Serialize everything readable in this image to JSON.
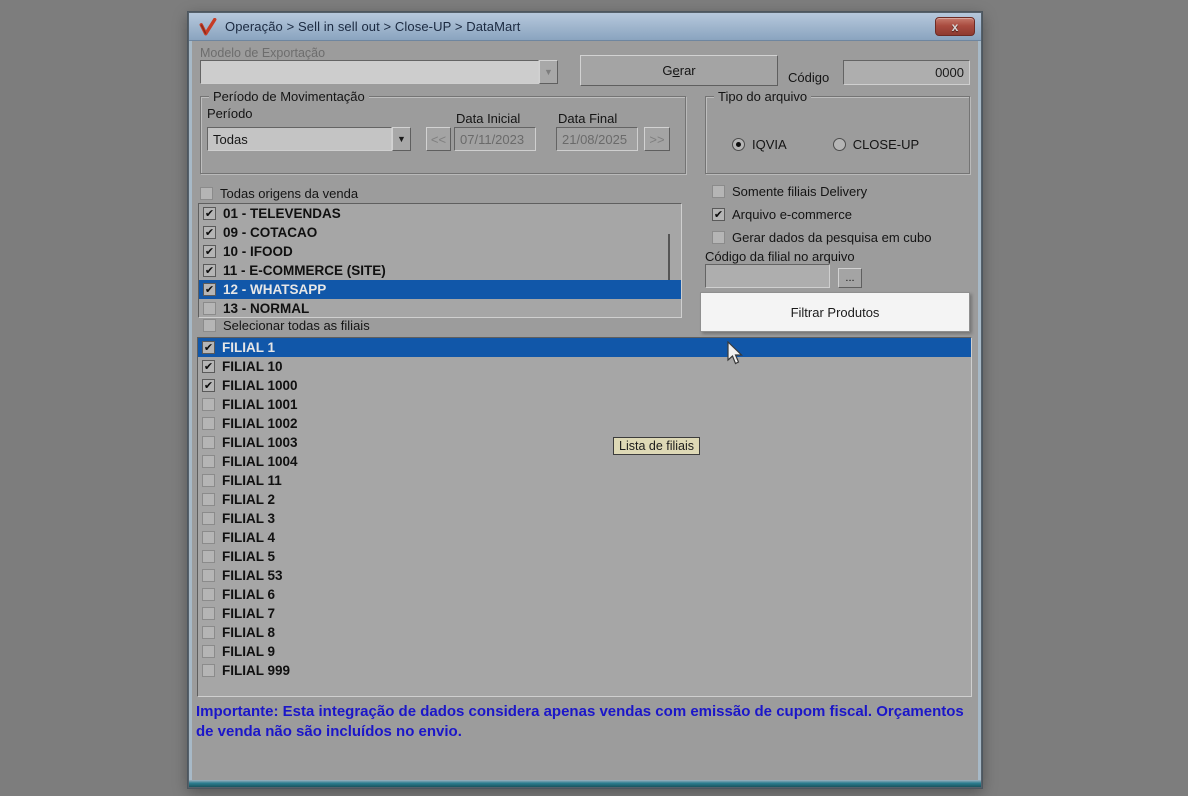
{
  "window": {
    "title": "Operação > Sell in sell out > Close-UP > DataMart",
    "close_glyph": "x"
  },
  "export_model": {
    "label": "Modelo de Exportação",
    "value": "",
    "arrow_glyph": "▼"
  },
  "gerar_button": {
    "pre": "G",
    "mnemonic": "e",
    "post": "rar"
  },
  "codigo": {
    "label": "Código",
    "value": "0000"
  },
  "periodo_group": {
    "title": "Período de Movimentação",
    "periodo_label": "Período",
    "periodo_value": "Todas",
    "arrow_glyph": "▼",
    "prev_label": "<<",
    "next_label": ">>",
    "data_inicial_label": "Data Inicial",
    "data_inicial_value": "07/11/2023",
    "data_final_label": "Data Final",
    "data_final_value": "21/08/2025"
  },
  "tipo_arquivo_group": {
    "title": "Tipo do arquivo",
    "options": [
      {
        "label": "IQVIA",
        "checked": true
      },
      {
        "label": "CLOSE-UP",
        "checked": false
      }
    ]
  },
  "origens": {
    "all_label": "Todas origens da venda",
    "all_checked": false,
    "items": [
      {
        "label": "01 - TELEVENDAS",
        "checked": true
      },
      {
        "label": "09 - COTACAO",
        "checked": true
      },
      {
        "label": "10 - IFOOD",
        "checked": true
      },
      {
        "label": "11 - E-COMMERCE (SITE)",
        "checked": true
      },
      {
        "label": "12 - WHATSAPP",
        "checked": true,
        "selected": true
      },
      {
        "label": "13 - NORMAL",
        "checked": false
      }
    ]
  },
  "opcoes": {
    "items": [
      {
        "label": "Somente filiais Delivery",
        "checked": false
      },
      {
        "label": "Arquivo e-commerce",
        "checked": true
      },
      {
        "label": "Gerar dados da pesquisa em cubo",
        "checked": false
      }
    ],
    "codigo_filial_label": "Código da filial no arquivo",
    "codigo_filial_value": "",
    "browse_label": "...",
    "filtrar_button": "Filtrar Produtos"
  },
  "filiais": {
    "all_label": "Selecionar todas as filiais",
    "all_checked": false,
    "tooltip": "Lista de filiais",
    "items": [
      {
        "label": "FILIAL 1",
        "checked": true,
        "selected": true
      },
      {
        "label": "FILIAL 10",
        "checked": true
      },
      {
        "label": "FILIAL 1000",
        "checked": true
      },
      {
        "label": "FILIAL 1001",
        "checked": false
      },
      {
        "label": "FILIAL 1002",
        "checked": false
      },
      {
        "label": "FILIAL 1003",
        "checked": false
      },
      {
        "label": "FILIAL 1004",
        "checked": false
      },
      {
        "label": "FILIAL 11",
        "checked": false
      },
      {
        "label": "FILIAL 2",
        "checked": false
      },
      {
        "label": "FILIAL 3",
        "checked": false
      },
      {
        "label": "FILIAL 4",
        "checked": false
      },
      {
        "label": "FILIAL 5",
        "checked": false
      },
      {
        "label": "FILIAL 53",
        "checked": false
      },
      {
        "label": "FILIAL 6",
        "checked": false
      },
      {
        "label": "FILIAL 7",
        "checked": false
      },
      {
        "label": "FILIAL 8",
        "checked": false
      },
      {
        "label": "FILIAL 9",
        "checked": false
      },
      {
        "label": "FILIAL 999",
        "checked": false
      }
    ]
  },
  "footer": {
    "message": "Importante: Esta integração de dados considera apenas vendas com emissão de cupom fiscal. Orçamentos de venda não são incluídos no envio."
  },
  "colors": {
    "selection": "#1157a9",
    "titlebar_from": "#b6c8dc",
    "titlebar_to": "#8aa4bf",
    "teal": "#2d7e90",
    "footer_blue": "#1b16c9",
    "tooltip_bg": "#ded9b6",
    "highlight_button_bg": "#f4f4f4",
    "close_red": "#a94c40",
    "logo_red": "#c63c26"
  }
}
